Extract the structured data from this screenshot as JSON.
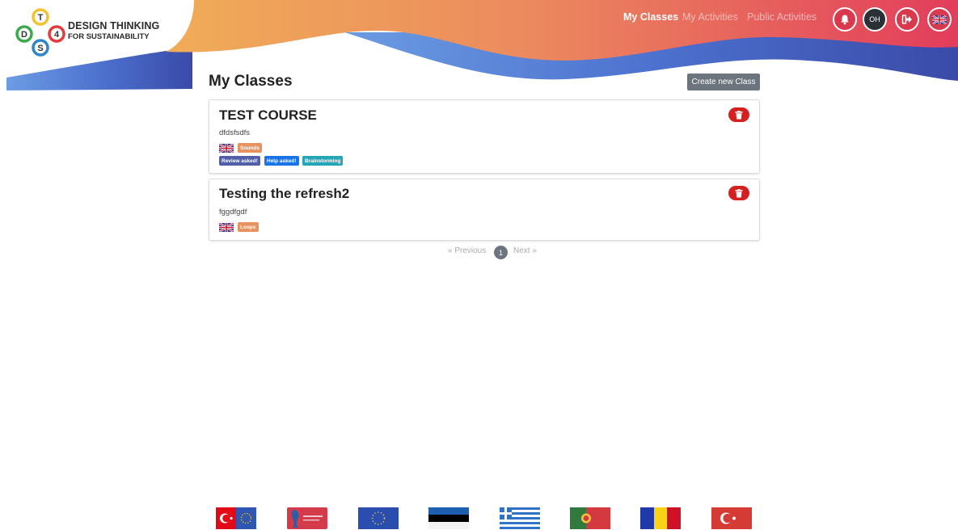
{
  "brand": {
    "line1": "DESIGN THINKING",
    "line2": "FOR SUSTAINABILITY",
    "logo_letters": [
      "T",
      "D",
      "4",
      "S"
    ]
  },
  "nav": {
    "items": [
      {
        "label": "My Classes",
        "active": true
      },
      {
        "label": "My Activities",
        "active": false
      },
      {
        "label": "Public Activities",
        "active": false
      }
    ],
    "icons": [
      "bell-icon",
      "user-avatar",
      "logout-icon",
      "uk-flag-icon"
    ],
    "avatar_initials": "OH"
  },
  "main": {
    "title": "My Classes",
    "create_button": "Create new Class",
    "classes": [
      {
        "title": "TEST COURSE",
        "description": "dfdsfsdfs",
        "language_flag": "uk-flag",
        "topic_tag": "Sounds",
        "status_badges": [
          "Review asked!",
          "Help asked!",
          "Brainstorming"
        ]
      },
      {
        "title": "Testing the refresh2",
        "description": "fggdfgdf",
        "language_flag": "uk-flag",
        "topic_tag": "Loops",
        "status_badges": []
      }
    ]
  },
  "pagination": {
    "previous": "« Previous",
    "current": "1",
    "next": "Next »"
  },
  "footer": {
    "flags": [
      "turkey-eu-flag",
      "partner-logo",
      "eu-flag",
      "estonia-flag",
      "greece-flag",
      "portugal-flag",
      "romania-flag",
      "turkey-flag"
    ]
  },
  "colors": {
    "header_orange": "#eea15b",
    "header_red": "#e2465a",
    "header_blue": "#4a66c8",
    "delete_red": "#d61f1f",
    "button_gray": "#6c757d"
  }
}
